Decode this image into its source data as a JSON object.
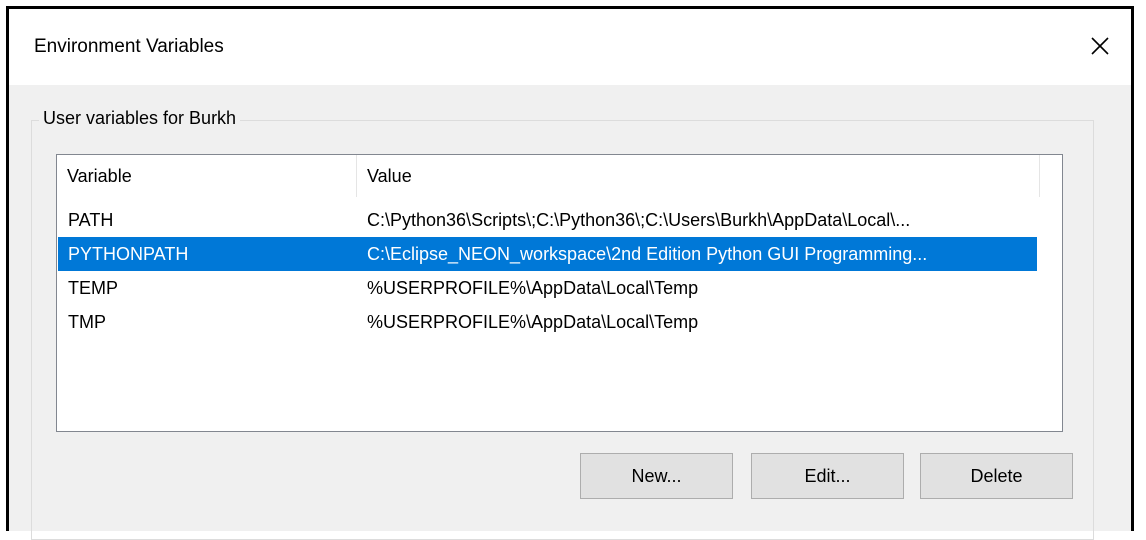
{
  "window": {
    "title": "Environment Variables",
    "close_icon": "close-icon"
  },
  "user_variables": {
    "group_label": "User variables for Burkh",
    "columns": [
      "Variable",
      "Value"
    ],
    "rows": [
      {
        "variable": "PATH",
        "value": "C:\\Python36\\Scripts\\;C:\\Python36\\;C:\\Users\\Burkh\\AppData\\Local\\...",
        "selected": false
      },
      {
        "variable": "PYTHONPATH",
        "value": "C:\\Eclipse_NEON_workspace\\2nd Edition Python GUI Programming...",
        "selected": true
      },
      {
        "variable": "TEMP",
        "value": "%USERPROFILE%\\AppData\\Local\\Temp",
        "selected": false
      },
      {
        "variable": "TMP",
        "value": "%USERPROFILE%\\AppData\\Local\\Temp",
        "selected": false
      }
    ]
  },
  "buttons": {
    "new_label": "New...",
    "edit_label": "Edit...",
    "delete_label": "Delete"
  },
  "colors": {
    "selection": "#0078d7",
    "dialog_background": "#f0f0f0",
    "button_face": "#e1e1e1"
  }
}
